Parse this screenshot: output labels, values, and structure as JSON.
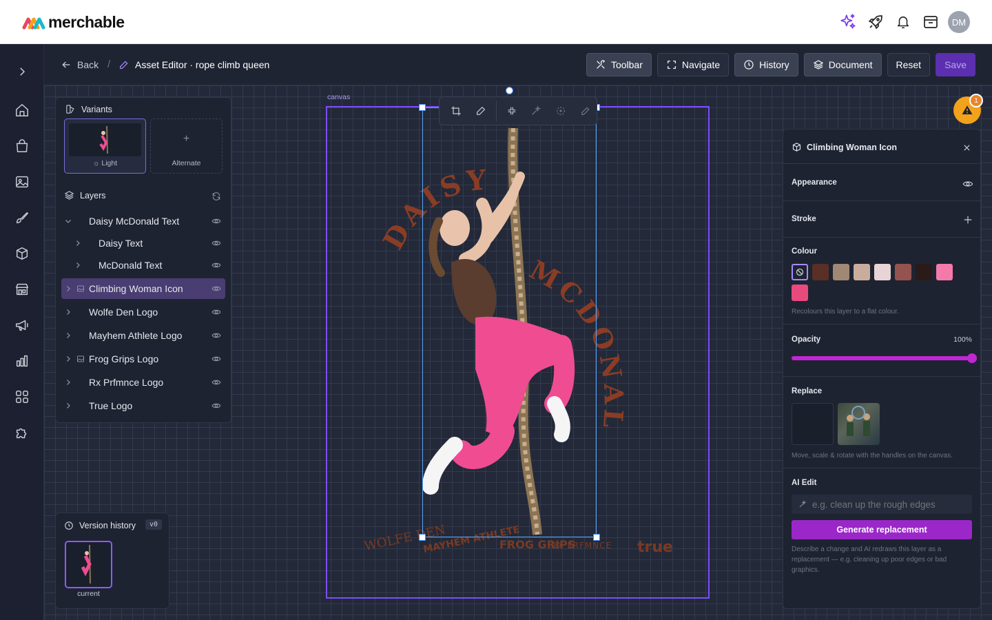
{
  "brand": {
    "name": "merchable"
  },
  "user": {
    "initials": "DM"
  },
  "header": {
    "back_label": "Back",
    "separator": "/",
    "title": "Asset Editor · rope climb queen",
    "buttons": {
      "toolbar": "Toolbar",
      "navigate": "Navigate",
      "history": "History",
      "document": "Document",
      "reset": "Reset",
      "save": "Save"
    }
  },
  "nav": [
    "expand-icon",
    "home-icon",
    "shopping-bag-icon",
    "image-icon",
    "brush-icon",
    "box-icon",
    "store-icon",
    "megaphone-icon",
    "chart-icon",
    "apps-icon",
    "puzzle-icon"
  ],
  "variants": {
    "title": "Variants",
    "items": [
      {
        "label": "Light",
        "selected": true
      },
      {
        "label": "Alternate",
        "selected": false
      }
    ]
  },
  "layers": {
    "title": "Layers",
    "items": [
      {
        "label": "Daisy McDonald Text",
        "expanded": true,
        "indent": 0
      },
      {
        "label": "Daisy Text",
        "indent": 1
      },
      {
        "label": "McDonald Text",
        "indent": 1
      },
      {
        "label": "Climbing Woman Icon",
        "selected": true,
        "indent": 0
      },
      {
        "label": "Wolfe Den Logo",
        "indent": 0
      },
      {
        "label": "Mayhem Athlete Logo",
        "indent": 0
      },
      {
        "label": "Frog Grips Logo",
        "indent": 0
      },
      {
        "label": "Rx Prfmnce Logo",
        "indent": 0
      },
      {
        "label": "True Logo",
        "indent": 0
      }
    ]
  },
  "version_history": {
    "title": "Version history",
    "badge": "v0",
    "current_label": "current"
  },
  "canvas": {
    "label": "canvas",
    "art_text": {
      "first": "DAISY",
      "last": "MCDONALD"
    },
    "logos": [
      "WOLFE DEN",
      "MAYHEM ATHLETE",
      "FROG GRIPS",
      "RX PRFMNCE",
      "true"
    ]
  },
  "warning": {
    "count": "1"
  },
  "inspector": {
    "title": "Climbing Woman Icon",
    "appearance": "Appearance",
    "stroke": "Stroke",
    "colour": {
      "label": "Colour",
      "swatches": [
        "#5a2f25",
        "#a08874",
        "#c9ad9c",
        "#e8d4d6",
        "#955350",
        "#2a1a18",
        "#f47aa9",
        "#e94a7d"
      ],
      "hint": "Recolours this layer to a flat colour."
    },
    "opacity": {
      "label": "Opacity",
      "value": "100%",
      "fraction": 1.0
    },
    "replace": {
      "label": "Replace",
      "hint": "Move, scale & rotate with the handles on the canvas."
    },
    "ai_edit": {
      "label": "AI Edit",
      "placeholder": "e.g. clean up the rough edges",
      "button": "Generate replacement",
      "hint": "Describe a change and AI redraws this layer as a replacement — e.g. cleaning up poor edges or bad graphics."
    }
  }
}
